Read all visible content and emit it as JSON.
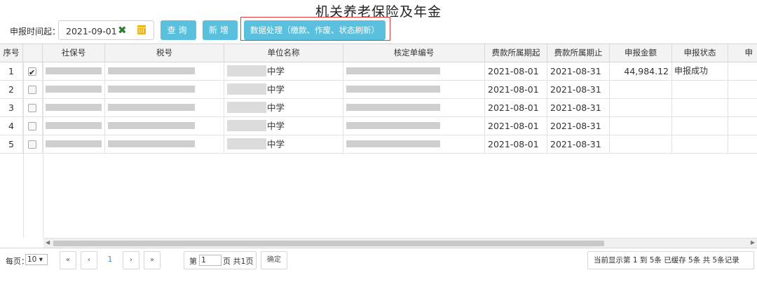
{
  "page_title": "机关养老保险及年金",
  "toolbar": {
    "period_label": "申报时间起：",
    "period_value": "2021-09-01",
    "query_label": "查询",
    "add_label": "新增",
    "process_label": "数据处理（缴款、作废、状态刷新）"
  },
  "table": {
    "columns": [
      "序号",
      "",
      "社保号",
      "税号",
      "单位名称",
      "核定单编号",
      "费款所属期起",
      "费款所属期止",
      "申报金额",
      "申报状态",
      "申"
    ],
    "rows": [
      {
        "index": "1",
        "checked": true,
        "unit_suffix": "中学",
        "period_start": "2021-08-01",
        "period_end": "2021-08-31",
        "amount": "44,984.12",
        "status": "申报成功"
      },
      {
        "index": "2",
        "checked": false,
        "unit_suffix": "中学",
        "period_start": "2021-08-01",
        "period_end": "2021-08-31",
        "amount": "",
        "status": ""
      },
      {
        "index": "3",
        "checked": false,
        "unit_suffix": "中学",
        "period_start": "2021-08-01",
        "period_end": "2021-08-31",
        "amount": "",
        "status": ""
      },
      {
        "index": "4",
        "checked": false,
        "unit_suffix": "中学",
        "period_start": "2021-08-01",
        "period_end": "2021-08-31",
        "amount": "",
        "status": ""
      },
      {
        "index": "5",
        "checked": false,
        "unit_suffix": "中学",
        "period_start": "2021-08-01",
        "period_end": "2021-08-31",
        "amount": "",
        "status": ""
      }
    ]
  },
  "pager": {
    "per_page_label": "每页：",
    "per_page_value": "10 ▾",
    "first": "«",
    "prev": "‹",
    "current_page": "1",
    "next": "›",
    "last": "»",
    "page_prefix": "第",
    "page_input": "1",
    "page_suffix": "页 共1页",
    "confirm_label": "确定",
    "summary": "当前显示第  1 到  5条 已缓存  5条 共  5条记录"
  }
}
